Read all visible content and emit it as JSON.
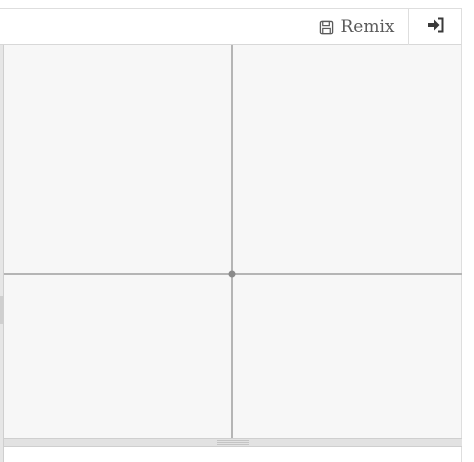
{
  "toolbar": {
    "remix_label": "Remix",
    "remix_icon": "floppy-disk-icon",
    "login_icon": "sign-in-icon"
  },
  "colors": {
    "canvas_background": "#f7f7f7",
    "axis_line": "#b5b5b5",
    "origin_point": "#8a8a8a",
    "login_icon": "#3a3a3a"
  }
}
